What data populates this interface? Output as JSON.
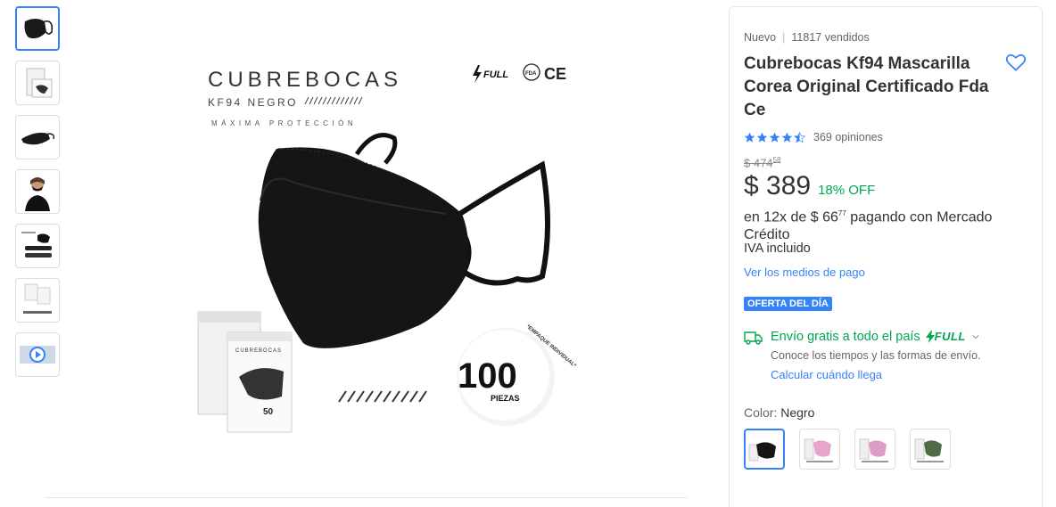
{
  "product": {
    "condition": "Nuevo",
    "sold": "11817 vendidos",
    "title": "Cubrebocas Kf94 Mascarilla Corea Original Certificado Fda Ce",
    "rating_count": "369 opiniones",
    "rating_value": 4.5,
    "original_price": "$ 474",
    "original_cents": "58",
    "price": "$ 389",
    "discount": "18% OFF",
    "installments_prefix": "en 12x de $ 66",
    "installments_cents": "77",
    "installments_suffix": " pagando con Mercado Crédito",
    "iva": "IVA incluido",
    "payment_link": "Ver los medios de pago",
    "deal_badge": "OFERTA DEL DÍA"
  },
  "shipping": {
    "text": "Envío gratis a todo el país",
    "full_label": "FULL",
    "subtext": "Conoce los tiempos y las formas de envío.",
    "calc_link": "Calcular cuándo llega"
  },
  "color": {
    "label": "Color: ",
    "selected": "Negro",
    "swatches": [
      "black",
      "pink",
      "pink",
      "green"
    ]
  },
  "image": {
    "heading": "CUBREBOCAS",
    "subheading": "KF94 NEGRO",
    "tagline": "MÁXIMA PROTECCIÓN",
    "full_badge": "FULL",
    "fda": "FDA",
    "ce": "CE",
    "box_label": "CUBREBOCAS",
    "box_count": "50",
    "count_big": "100",
    "count_small": "PIEZAS",
    "circle_text": "*EMPAQUE INDIVIDUAL*"
  },
  "colors": {
    "accent": "#3483fa",
    "green": "#00a650"
  },
  "thumbnails": [
    "mask-front",
    "box",
    "mask-side",
    "person",
    "specs",
    "certificate",
    "video"
  ]
}
